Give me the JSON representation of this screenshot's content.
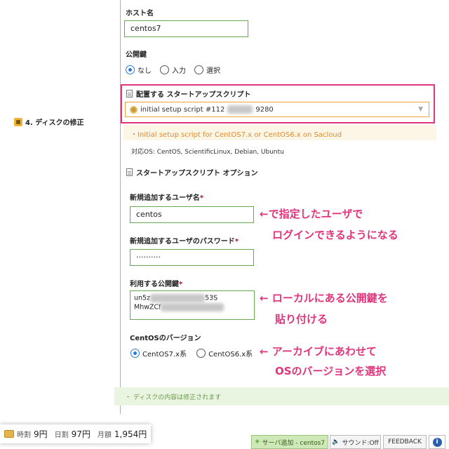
{
  "step": {
    "label": "4. ディスクの修正"
  },
  "hostname": {
    "label": "ホスト名",
    "value": "centos7"
  },
  "pubkey": {
    "label": "公開鍵",
    "options": [
      "なし",
      "入力",
      "選択"
    ],
    "selected": "なし"
  },
  "startup_script": {
    "label": "配置する スタートアップスクリプト",
    "selected_prefix": "initial setup script #112",
    "selected_suffix": "9280",
    "info": "・Initial setup script for CentOS7.x or CentOS6.x on Sacloud",
    "compat": "対応OS: CentOS, ScientificLinux, Debian, Ubuntu"
  },
  "options_section": {
    "title": "スタートアップスクリプト オプション",
    "new_user": {
      "label": "新規追加するユーザ名",
      "required": "*",
      "value": "centos"
    },
    "new_password": {
      "label": "新規追加するユーザのパスワード",
      "required": "*",
      "value": "··········"
    },
    "public_key": {
      "label": "利用する公開鍵",
      "required": "*",
      "line1_prefix": "un5z",
      "line1_suffix": "53S",
      "line2_prefix": "MhwZCf"
    },
    "centos_version": {
      "label": "CentOSのバージョン",
      "options": [
        "CentOS7.x系",
        "CentOS6.x系"
      ],
      "selected": "CentOS7.x系"
    }
  },
  "annotations": {
    "a1_line1": "←で指定したユーザで",
    "a1_line2": "ログインできるようになる",
    "a2_line1": "← ローカルにある公開鍵を",
    "a2_line2": "貼り付ける",
    "a3_line1": "← アーカイブにあわせて",
    "a3_line2": "OSのバージョンを選択"
  },
  "notice": "・ ディスクの内容は修正されます",
  "pricing": {
    "hourly_label": "時割",
    "hourly_value": "9円",
    "daily_label": "日割",
    "daily_value": "97円",
    "monthly_label": "月額",
    "monthly_value": "1,954円"
  },
  "footer": {
    "add_server": "サーバ追加 - centos7",
    "sound": "サウンド:Off",
    "feedback": "FEEDBACK",
    "info": "i"
  },
  "colors": {
    "accent": "#f0a23a",
    "annotation": "#e0357c",
    "valid_border": "#6aa84f",
    "radio": "#2a7bd4"
  }
}
